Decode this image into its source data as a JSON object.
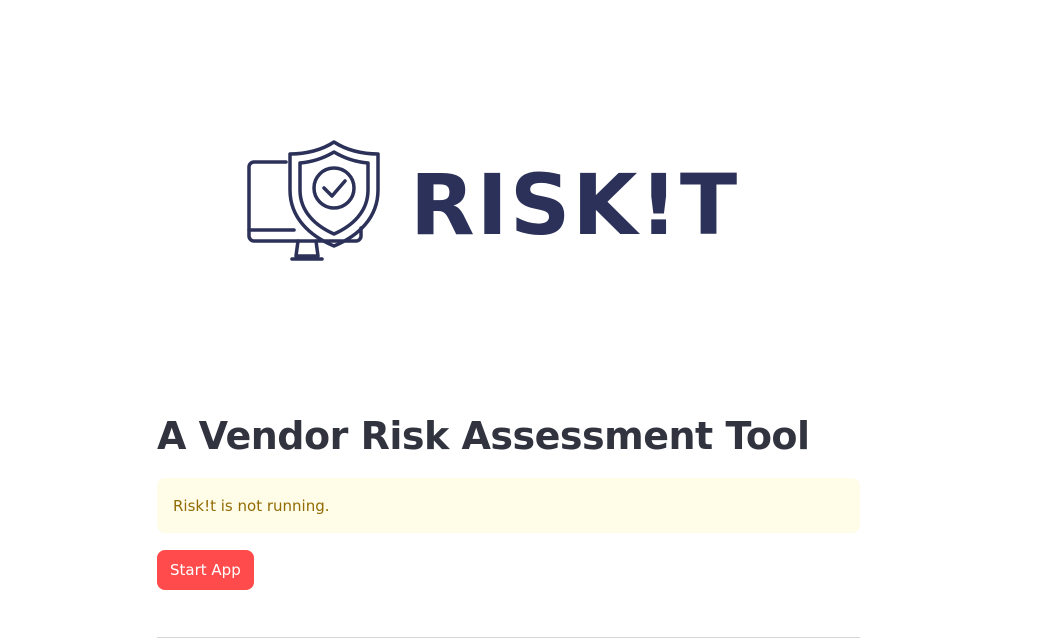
{
  "logo": {
    "wordmark": "RISK!T",
    "icon": "shield-check-monitor-icon",
    "color": "#2b3158"
  },
  "main": {
    "title": "A Vendor Risk Assessment Tool",
    "status_message": "Risk!t is not running.",
    "start_button_label": "Start App"
  },
  "colors": {
    "title": "#31333f",
    "alert_background": "#fffce7",
    "alert_text": "#926c05",
    "primary_button": "#ff4b4b"
  }
}
